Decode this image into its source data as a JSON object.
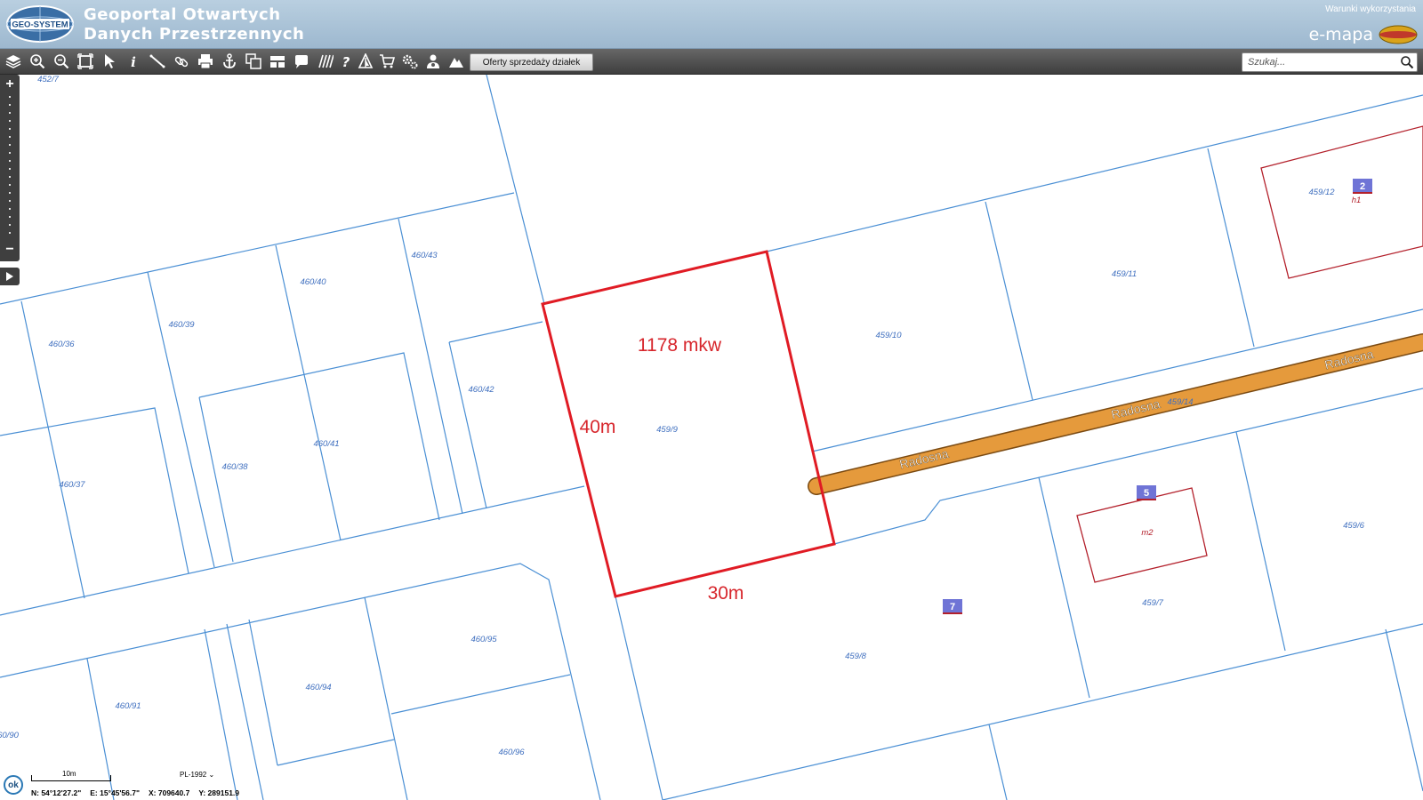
{
  "header": {
    "logo_text": "GEO-SYSTEM",
    "title_line1": "Geoportal Otwartych",
    "title_line2": "Danych Przestrzennych",
    "terms_link": "Warunki wykorzystania",
    "brand": "e-mapa"
  },
  "toolbar": {
    "tools": [
      "layers-icon",
      "zoom-in-icon",
      "zoom-out-icon",
      "zoom-extent-icon",
      "select-arrow-icon",
      "info-icon",
      "measure-icon",
      "link-icon",
      "print-icon",
      "anchor-icon",
      "copy-icon",
      "layout-icon",
      "comment-icon",
      "hatch-icon",
      "help-icon",
      "sign-icon",
      "cart-icon",
      "settings-icon",
      "users-icon",
      "terrain-icon"
    ],
    "offers_button": "Oferty sprzedaży działek",
    "search_placeholder": "Szukaj..."
  },
  "map": {
    "annotations": {
      "area": "1178 mkw",
      "side_left": "40m",
      "side_bottom": "30m"
    },
    "street_labels": [
      "Radosna",
      "Radosna",
      "Radosna"
    ],
    "parcels": [
      {
        "id": "452/7"
      },
      {
        "id": "460/40"
      },
      {
        "id": "460/43"
      },
      {
        "id": "460/39"
      },
      {
        "id": "460/36"
      },
      {
        "id": "460/42"
      },
      {
        "id": "460/41"
      },
      {
        "id": "460/38"
      },
      {
        "id": "460/37"
      },
      {
        "id": "460/95"
      },
      {
        "id": "460/94"
      },
      {
        "id": "460/91"
      },
      {
        "id": "460/96"
      },
      {
        "id": "60/90"
      },
      {
        "id": "459/9"
      },
      {
        "id": "459/10"
      },
      {
        "id": "459/11"
      },
      {
        "id": "459/12"
      },
      {
        "id": "459/14"
      },
      {
        "id": "459/8"
      },
      {
        "id": "459/7"
      },
      {
        "id": "459/6"
      }
    ],
    "building_labels": [
      "h1",
      "m2"
    ],
    "badges": [
      "2",
      "5",
      "7"
    ],
    "colors": {
      "parcel_line": "#4a8fd4",
      "parcel_label": "#3f6fbf",
      "highlight": "#e01b24",
      "road": "#e59a3c",
      "building": "#b3202b",
      "badge": "#6f74d6"
    }
  },
  "status": {
    "ok_label": "ok",
    "scale_label": "10m",
    "projection": "PL-1992",
    "lat": "N: 54°12'27.2\"",
    "lon": "E: 15°45'56.7\"",
    "x": "X: 709640.7",
    "y": "Y: 289151.9"
  }
}
